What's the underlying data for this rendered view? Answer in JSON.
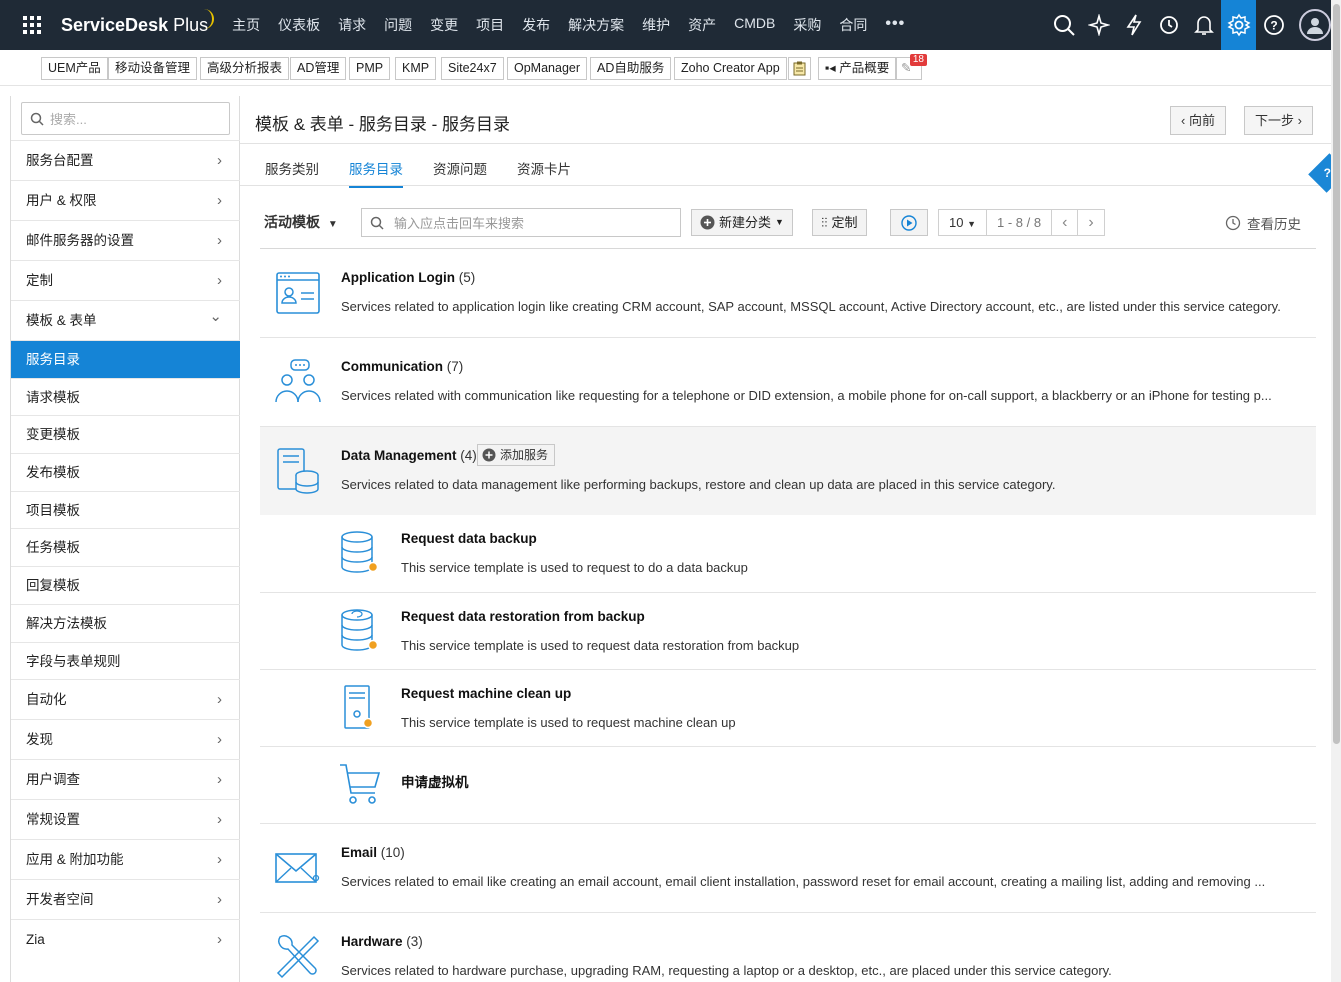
{
  "app": {
    "name": "ServiceDesk",
    "name_plus": "Plus"
  },
  "nav": [
    "主页",
    "仪表板",
    "请求",
    "问题",
    "变更",
    "项目",
    "发布",
    "解决方案",
    "维护",
    "资产",
    "CMDB",
    "采购",
    "合同"
  ],
  "nav_more": "•••",
  "top_icons": [
    "search-icon",
    "sparkle-icon",
    "lightning-icon",
    "history-icon",
    "bell-icon",
    "gear-icon",
    "help-icon",
    "user-avatar-icon"
  ],
  "products": [
    "UEM产品",
    "移动设备管理",
    "高级分析报表",
    "AD管理",
    "PMP",
    "KMP",
    "Site24x7",
    "OpManager",
    "AD自助服务",
    "Zoho Creator App"
  ],
  "product_overview": "产品概要",
  "notify_badge": "18",
  "sidebar": {
    "search_placeholder": "搜索...",
    "items": [
      {
        "label": "服务台配置",
        "type": "group"
      },
      {
        "label": "用户 & 权限",
        "type": "group"
      },
      {
        "label": "邮件服务器的设置",
        "type": "group"
      },
      {
        "label": "定制",
        "type": "group"
      },
      {
        "label": "模板 & 表单",
        "type": "open"
      },
      {
        "label": "服务目录",
        "type": "sub",
        "active": true
      },
      {
        "label": "请求模板",
        "type": "sub"
      },
      {
        "label": "变更模板",
        "type": "sub"
      },
      {
        "label": "发布模板",
        "type": "sub"
      },
      {
        "label": "项目模板",
        "type": "sub"
      },
      {
        "label": "任务模板",
        "type": "sub"
      },
      {
        "label": "回复模板",
        "type": "sub"
      },
      {
        "label": "解决方法模板",
        "type": "sub"
      },
      {
        "label": "字段与表单规则",
        "type": "sub"
      },
      {
        "label": "自动化",
        "type": "group"
      },
      {
        "label": "发现",
        "type": "group"
      },
      {
        "label": "用户调查",
        "type": "group"
      },
      {
        "label": "常规设置",
        "type": "group"
      },
      {
        "label": "应用 & 附加功能",
        "type": "group"
      },
      {
        "label": "开发者空间",
        "type": "group"
      },
      {
        "label": "Zia",
        "type": "group"
      }
    ]
  },
  "page": {
    "title": "模板 & 表单 - 服务目录 - 服务目录",
    "prev_label": "向前",
    "next_label": "下一步",
    "tabs": [
      "服务类别",
      "服务目录",
      "资源问题",
      "资源卡片"
    ],
    "active_tab": 1
  },
  "toolbar": {
    "filter": "活动模板",
    "search_placeholder": "输入应点击回车来搜索",
    "new_category": "新建分类",
    "customize": "定制",
    "per_page": "10",
    "range": "1 - 8 / 8",
    "history": "查看历史"
  },
  "categories": [
    {
      "name": "Application Login",
      "count": "(5)",
      "desc": "Services related to application login like creating CRM account, SAP account, MSSQL account, Active Directory account, etc., are listed under this service category.",
      "icon": "app-login-icon"
    },
    {
      "name": "Communication",
      "count": "(7)",
      "desc": "Services related with communication like requesting for a telephone or DID extension, a mobile phone for on-call support, a blackberry or an iPhone for testing p...",
      "icon": "communication-icon"
    },
    {
      "name": "Data Management",
      "count": "(4)",
      "desc": "Services related to data management like performing backups, restore and clean up data are placed in this service category.",
      "icon": "data-management-icon",
      "add_service": "添加服务"
    },
    {
      "name": "Email",
      "count": "(10)",
      "desc": "Services related to email like creating an email account, email client installation, password reset for email account, creating a mailing list, adding and removing ...",
      "icon": "email-icon"
    },
    {
      "name": "Hardware",
      "count": "(3)",
      "desc": "Services related to hardware purchase, upgrading RAM, requesting a laptop or a desktop, etc., are placed under this service category.",
      "icon": "hardware-icon"
    }
  ],
  "services": [
    {
      "name": "Request data backup",
      "desc": "This service template is used to request to do a data backup",
      "icon": "database-icon"
    },
    {
      "name": "Request data restoration from backup",
      "desc": "This service template is used to request data restoration from backup",
      "icon": "database-restore-icon"
    },
    {
      "name": "Request machine clean up",
      "desc": "This service template is used to request machine clean up",
      "icon": "server-icon"
    },
    {
      "name": "申请虚拟机",
      "desc": "",
      "icon": "cart-icon"
    }
  ],
  "colors": {
    "accent": "#1584d6",
    "topbar": "#1f2a36",
    "badge": "#e23b3b"
  }
}
